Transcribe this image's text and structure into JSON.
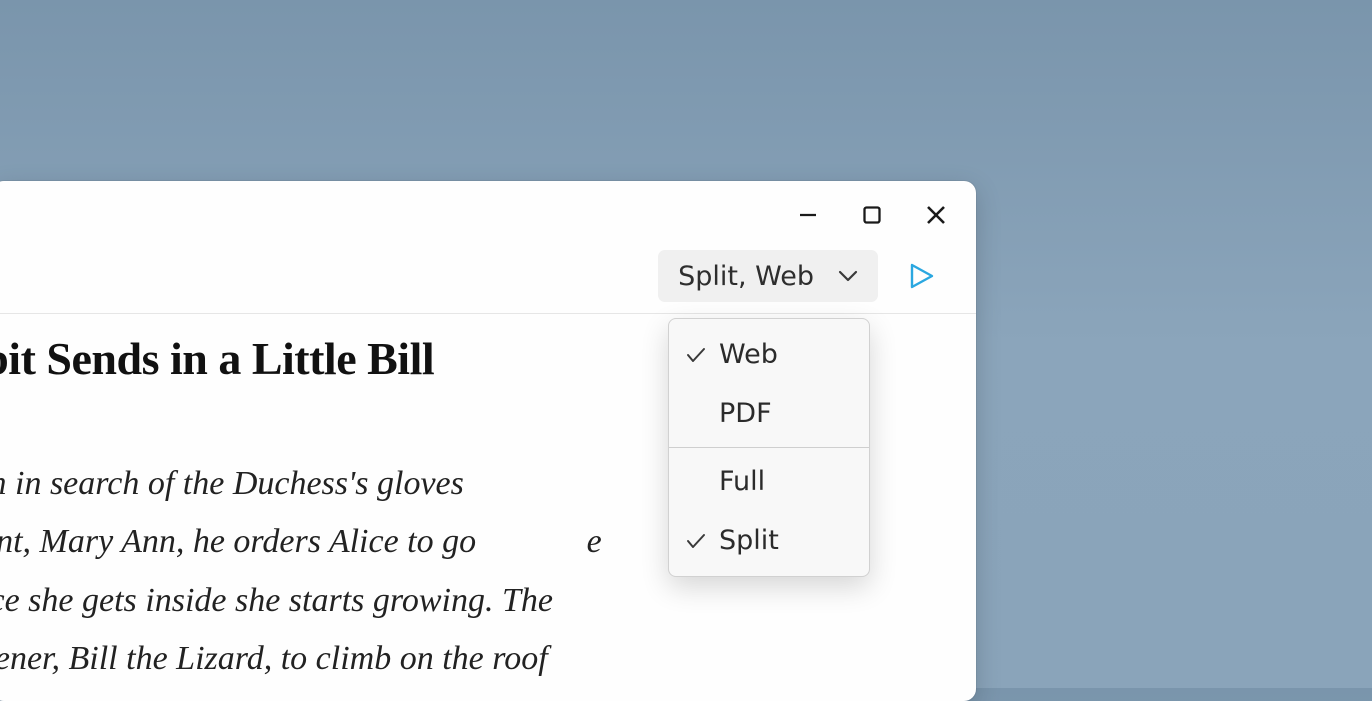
{
  "window_controls": {
    "minimize": "minimize",
    "maximize": "maximize",
    "close": "close"
  },
  "toolbar": {
    "dropdown_label": "Split, Web",
    "play": "play"
  },
  "menu": {
    "items": [
      {
        "label": "Web",
        "checked": true
      },
      {
        "label": "PDF",
        "checked": false
      }
    ],
    "items2": [
      {
        "label": "Full",
        "checked": false
      },
      {
        "label": "Split",
        "checked": true
      }
    ]
  },
  "document": {
    "heading": "e Rabbit Sends in a Little Bill",
    "lines": [
      "ears again in search of the Duchess's gloves",
      "naidservant, Mary Ann, he orders Alice to go             e",
      "m, but once she gets inside she starts growing. The",
      "s his gardener, Bill the Lizard, to climb on the roof"
    ]
  }
}
